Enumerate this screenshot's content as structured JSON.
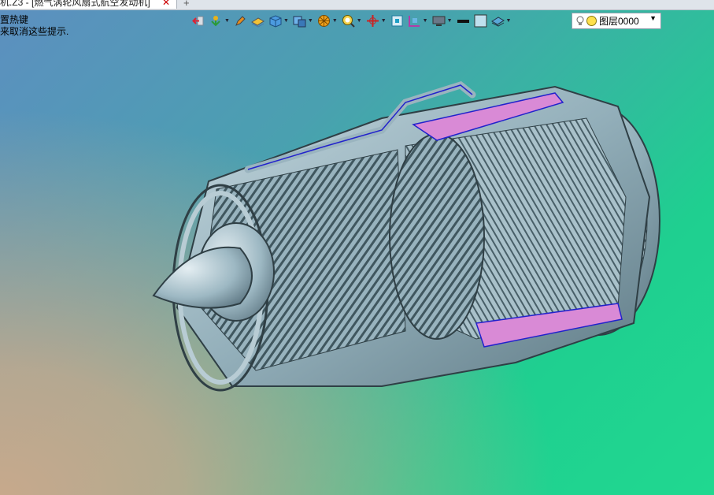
{
  "tab": {
    "title": "机.Z3 - [燃气涡轮风扇式航空发动机]",
    "close": "✕",
    "new_tab": "+"
  },
  "hint": {
    "line1": "置热键",
    "line2": "来取消这些提示."
  },
  "toolbar": {
    "tools": [
      "exit-icon",
      "move-icon",
      "pen-icon",
      "layer-flat-icon",
      "cube-icon",
      "view-cube-icon",
      "render-icon",
      "zoom-icon",
      "axis-icon",
      "frame-icon",
      "section-icon",
      "display-icon"
    ],
    "color_swatch": "#111111",
    "fill_swatch": "#bfe0ee",
    "layer": {
      "name": "图层0000",
      "bulb": "light-bulb-icon",
      "dot_color": "#ffe14d"
    }
  },
  "colors": {
    "metal": "#9ab4bf",
    "metal_dark": "#4d646e",
    "pink": "#d98ad6",
    "blue_line": "#2222cc"
  }
}
